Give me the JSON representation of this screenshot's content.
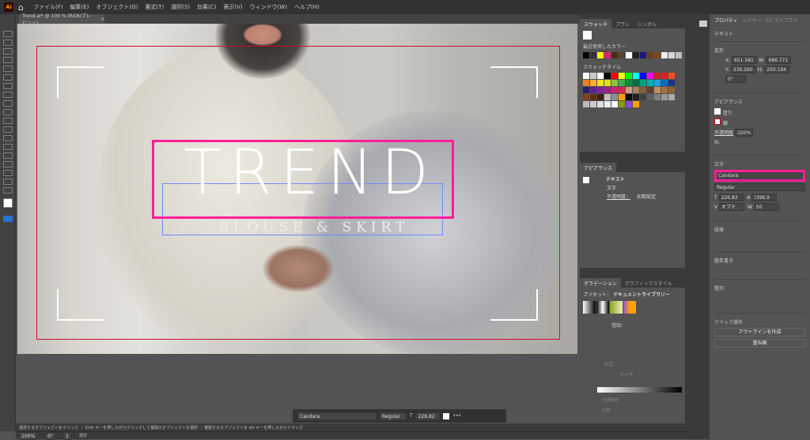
{
  "app": {
    "logo": "Ai",
    "menu": [
      "ファイル(F)",
      "編集(E)",
      "オブジェクト(O)",
      "書式(T)",
      "選択(S)",
      "効果(C)",
      "表示(V)",
      "ウィンドウ(W)",
      "ヘルプ(H)"
    ]
  },
  "document_tab": {
    "title": "Trend.ai* @ 100 % (RGB/プレビュー)",
    "close": "×"
  },
  "artwork": {
    "headline": "TREND",
    "subline": "BLOUSE & SKIRT",
    "selection_color": "#ff1e96"
  },
  "swatches": {
    "tabs": [
      "スウォッチ",
      "ブラシ",
      "シンボル"
    ],
    "recent_label": "最近使用したカラー",
    "recent": [
      "#000000",
      "#333333",
      "#ffff00",
      "#e0207a",
      "#4a2a10",
      "#5a4030",
      "#ffffff",
      "#222222",
      "#1a1a80",
      "#6a4020",
      "#7a4818",
      "#f0f0f0",
      "#d8d8d8",
      "#c0c0c0"
    ],
    "tile_label": "スウォッチタイル",
    "tiles": [
      "#ffffff",
      "#cccccc",
      "#ffffff",
      "#000000",
      "#ff0000",
      "#ffff00",
      "#00ff00",
      "#00ffff",
      "#0000ff",
      "#ff00ff",
      "#d02020",
      "#e02020",
      "#f05020",
      "#f08020",
      "#f0b030",
      "#f0e020",
      "#e0e020",
      "#8cc040",
      "#40b040",
      "#009040",
      "#007040",
      "#00a080",
      "#00b0b0",
      "#20a0e0",
      "#0070c0",
      "#203090",
      "#202070",
      "#602090",
      "#8020a0",
      "#a02080",
      "#d02070",
      "#e02050",
      "#c0a080",
      "#a08060",
      "#806040",
      "#604030",
      "#c09060",
      "#a07040",
      "#906030",
      "#804020",
      "#603010",
      "#402010",
      "#c0c0c0",
      "#909090",
      "#ffa000",
      "#000000",
      "#202020",
      "#404040",
      "#606060",
      "#808080",
      "#999999",
      "#aaaaaa",
      "#bbbbbb",
      "#cccccc",
      "#dddddd",
      "#eeeeee",
      "#ffffff",
      "#80a000",
      "#9040e0",
      "#ffa000"
    ]
  },
  "appearance": {
    "tab": "アピアランス",
    "item": "テキスト",
    "sub": "文字",
    "opacity_label": "不透明度：",
    "opacity_value": "初期設定"
  },
  "gradient": {
    "tabs": [
      "グラデーション",
      "グラフィックスタイル"
    ],
    "preset_label": "プリセット：",
    "preset_value": "ドキュメントライブラリー",
    "type_label": "種類：",
    "method_label": "方式：",
    "dither_label": "ディザ",
    "opacity_label": "不透明度：",
    "position_label": "位置："
  },
  "properties": {
    "tabs": [
      "プロパティ",
      "レイヤー",
      "CC ライブラリ"
    ],
    "kind": "テキスト",
    "transform_label": "変形",
    "x": "651.581",
    "y": "339.260",
    "w": "686.771",
    "h": "250.194",
    "angle": "0°",
    "appearance_label": "アピアランス",
    "fill_label": "塗り",
    "stroke_label": "線",
    "opacity_label": "不透明度",
    "opacity": "100%",
    "fx": "fx.",
    "char_label": "文字",
    "font": "Candara",
    "style": "Regular",
    "size": "226.83",
    "leading": "(396.9",
    "kerning": "オプチ.",
    "tracking": "50",
    "para_label": "段落",
    "bullets_label": "箇条書き",
    "align_label": "整列",
    "quick_label": "クイック操作",
    "outline_btn": "アウトラインを作成",
    "arrange_btn": "重ね順"
  },
  "context_bar": {
    "font": "Candara",
    "style": "Regular",
    "size": "226.82"
  },
  "status": {
    "hint": "選択するオブジェクトをクリック ｜ Shift キーを押しながらクリックして複数のオブジェクトを選択 ｜ 複製するオブジェクトを Alt キーを押しながらドラッグ",
    "zoom": "100%",
    "rotation": "0°",
    "artboard": "1",
    "mode": "選択"
  }
}
